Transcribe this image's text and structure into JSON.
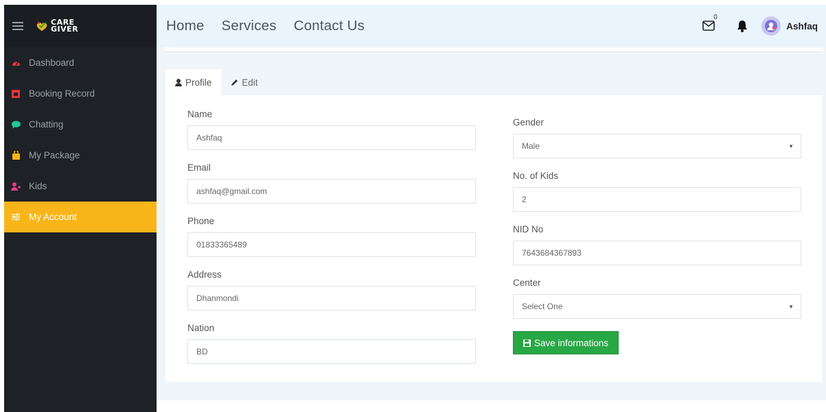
{
  "brand": {
    "logo_text_line1": "CARE",
    "logo_text_line2": "GIVER"
  },
  "sidebar": {
    "items": [
      {
        "label": "Dashboard",
        "icon": "tachometer-icon",
        "color": "#e3343a"
      },
      {
        "label": "Booking Record",
        "icon": "calendar-icon",
        "color": "#e3343a"
      },
      {
        "label": "Chatting",
        "icon": "chat-bubble-icon",
        "color": "#20c997"
      },
      {
        "label": "My Package",
        "icon": "package-icon",
        "color": "#f7b51a"
      },
      {
        "label": "Kids",
        "icon": "add-user-icon",
        "color": "#e83e8c"
      },
      {
        "label": "My Account",
        "icon": "sliders-icon",
        "active": true
      }
    ]
  },
  "header": {
    "nav": [
      "Home",
      "Services",
      "Contact Us"
    ],
    "mail_count": "0",
    "username": "Ashfaq"
  },
  "tabs": [
    {
      "label": "Profile",
      "icon": "user-icon",
      "active": true
    },
    {
      "label": "Edit",
      "icon": "pencil-icon"
    }
  ],
  "form": {
    "name": {
      "label": "Name",
      "value": "Ashfaq"
    },
    "email": {
      "label": "Email",
      "value": "ashfaq@gmail.com"
    },
    "phone": {
      "label": "Phone",
      "value": "01833365489"
    },
    "address": {
      "label": "Address",
      "value": "Dhanmondi"
    },
    "nation": {
      "label": "Nation",
      "value": "BD"
    },
    "gender": {
      "label": "Gender",
      "value": "Male"
    },
    "kids": {
      "label": "No. of Kids",
      "value": "2"
    },
    "nid": {
      "label": "NID No",
      "value": "7643684367893"
    },
    "center": {
      "label": "Center",
      "value": "Select One"
    },
    "save_label": "Save informations"
  },
  "colors": {
    "sidebar_bg": "#1e2226",
    "active_item": "#f7b51a",
    "header_bg": "#e9f4fc",
    "save_button": "#28a745"
  }
}
